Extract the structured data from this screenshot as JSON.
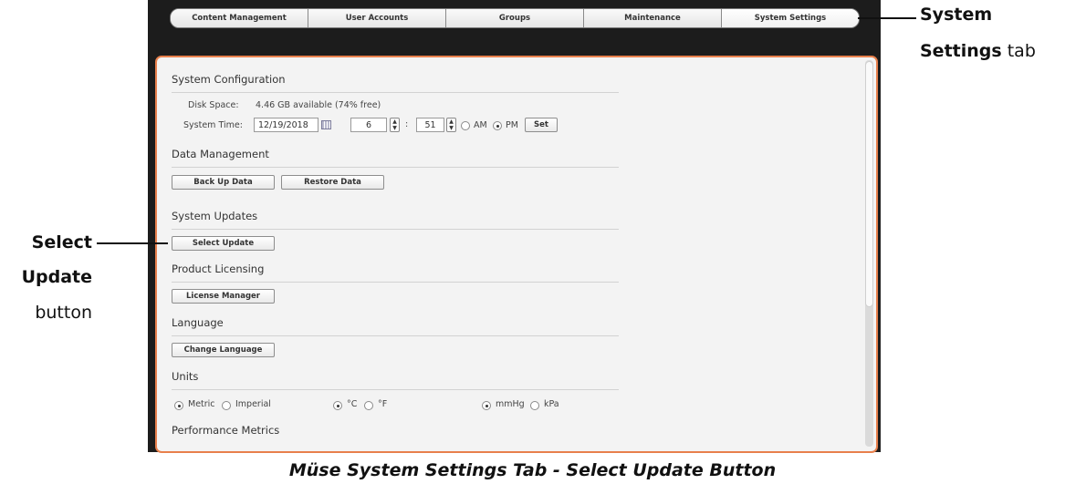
{
  "tabs": [
    {
      "label": "Content Management"
    },
    {
      "label": "User Accounts"
    },
    {
      "label": "Groups"
    },
    {
      "label": "Maintenance"
    },
    {
      "label": "System Settings",
      "selected": true
    }
  ],
  "system_configuration": {
    "title": "System Configuration",
    "disk_space_label": "Disk Space:",
    "disk_space_value": "4.46 GB available (74% free)",
    "system_time_label": "System Time:",
    "date_value": "12/19/2018",
    "hour_value": "6",
    "colon": ":",
    "minute_value": "51",
    "am_label": "AM",
    "pm_label": "PM",
    "meridiem_selected": "PM",
    "set_label": "Set"
  },
  "data_management": {
    "title": "Data Management",
    "backup_label": "Back Up Data",
    "restore_label": "Restore Data"
  },
  "system_updates": {
    "title": "System Updates",
    "select_update_label": "Select Update"
  },
  "product_licensing": {
    "title": "Product Licensing",
    "license_manager_label": "License Manager"
  },
  "language": {
    "title": "Language",
    "change_language_label": "Change Language"
  },
  "units": {
    "title": "Units",
    "metric_label": "Metric",
    "imperial_label": "Imperial",
    "celsius_label": "°C",
    "fahrenheit_label": "°F",
    "mmhg_label": "mmHg",
    "kpa_label": "kPa",
    "selected_system": "Metric",
    "selected_temperature": "°C",
    "selected_pressure": "mmHg"
  },
  "performance_metrics": {
    "title": "Performance Metrics"
  },
  "annotations": {
    "tab_bold_1": "System",
    "tab_bold_2": "Settings",
    "tab_rest": " tab",
    "button_bold_1": "Select",
    "button_bold_2": "Update",
    "button_rest": "button"
  },
  "caption": "Müse System Settings Tab - Select Update Button",
  "colors": {
    "panel_border": "#e8804c",
    "frame": "#1c1c1c",
    "panel_background": "#f3f3f3"
  },
  "icons": [
    "calendar-icon",
    "stepper-up-icon",
    "stepper-down-icon"
  ]
}
